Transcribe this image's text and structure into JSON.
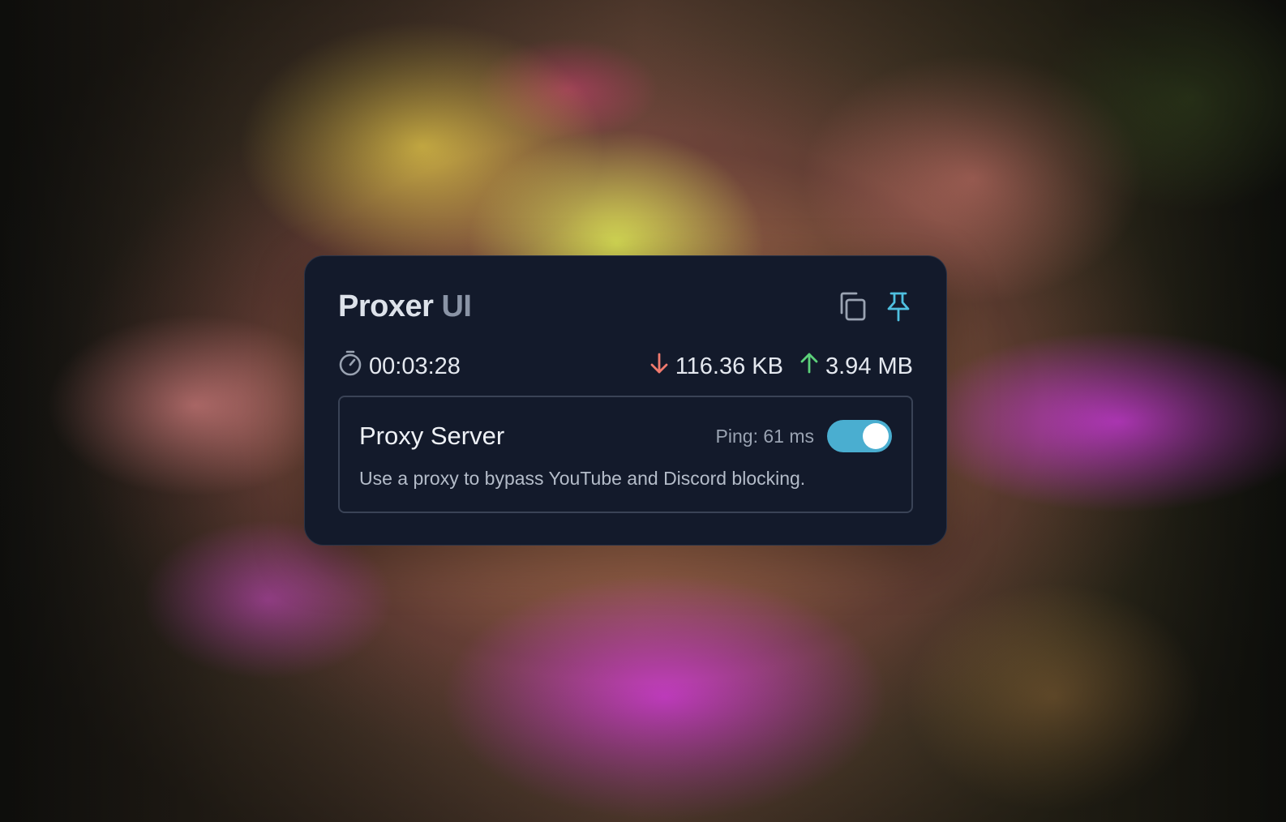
{
  "app": {
    "title_primary": "Proxer",
    "title_secondary": "UI"
  },
  "header_actions": [
    {
      "name": "copy-icon"
    },
    {
      "name": "pin-icon"
    }
  ],
  "stats": {
    "timer": "00:03:28",
    "download": "116.36 KB",
    "upload": "3.94 MB"
  },
  "proxy_card": {
    "title": "Proxy Server",
    "ping": "Ping: 61 ms",
    "enabled": true,
    "description": "Use a proxy to bypass YouTube and Discord blocking."
  },
  "colors": {
    "panel_bg": "#131a2b",
    "download_arrow": "#f07a6e",
    "upload_arrow": "#5cd17a",
    "pin_icon": "#4fc0e0",
    "toggle_on": "#4aaed0"
  }
}
